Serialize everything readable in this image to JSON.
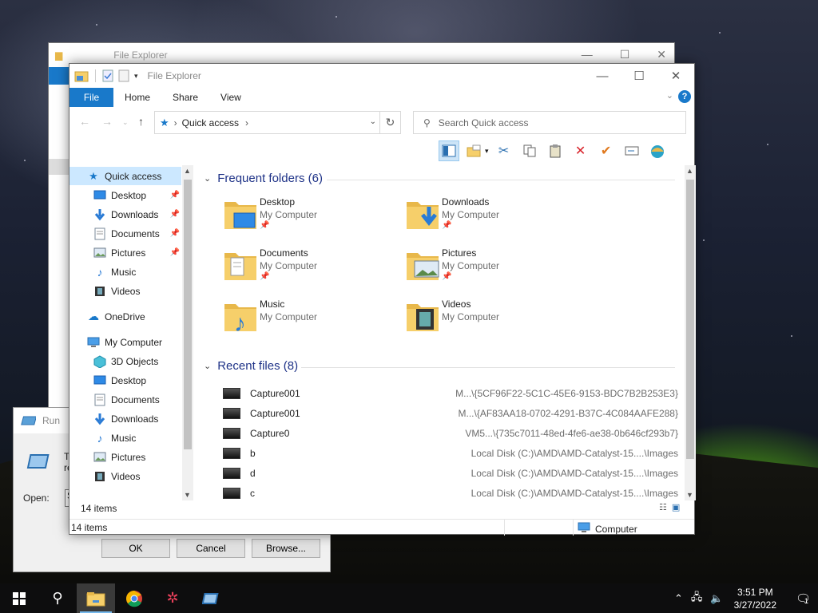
{
  "background_window": {
    "title": "File Explorer"
  },
  "run_dialog": {
    "title": "Run",
    "description_partial": "Ty\nre",
    "open_label": "Open:",
    "open_value": "S",
    "ok_label": "OK",
    "cancel_label": "Cancel",
    "browse_label": "Browse..."
  },
  "explorer": {
    "title": "File Explorer",
    "ribbon_tabs": [
      "File",
      "Home",
      "Share",
      "View"
    ],
    "help_label": "?",
    "address_crumb": "Quick access",
    "search_placeholder": "Search Quick access",
    "nav": [
      {
        "label": "Quick access",
        "icon": "star-icon",
        "selected": true,
        "pinned": false,
        "indent": 0
      },
      {
        "label": "Desktop",
        "icon": "desktop-icon",
        "pinned": true,
        "indent": 1
      },
      {
        "label": "Downloads",
        "icon": "downloads-icon",
        "pinned": true,
        "indent": 1
      },
      {
        "label": "Documents",
        "icon": "documents-icon",
        "pinned": true,
        "indent": 1
      },
      {
        "label": "Pictures",
        "icon": "pictures-icon",
        "pinned": true,
        "indent": 1
      },
      {
        "label": "Music",
        "icon": "music-icon",
        "pinned": false,
        "indent": 1
      },
      {
        "label": "Videos",
        "icon": "videos-icon",
        "pinned": false,
        "indent": 1
      },
      {
        "label": "OneDrive",
        "icon": "cloud-icon",
        "pinned": false,
        "indent": 0
      },
      {
        "label": "My Computer",
        "icon": "computer-icon",
        "pinned": false,
        "indent": 0
      },
      {
        "label": "3D Objects",
        "icon": "cube-icon",
        "pinned": false,
        "indent": 1
      },
      {
        "label": "Desktop",
        "icon": "desktop-icon",
        "pinned": false,
        "indent": 1
      },
      {
        "label": "Documents",
        "icon": "documents-icon",
        "pinned": false,
        "indent": 1
      },
      {
        "label": "Downloads",
        "icon": "downloads-icon",
        "pinned": false,
        "indent": 1
      },
      {
        "label": "Music",
        "icon": "music-icon",
        "pinned": false,
        "indent": 1
      },
      {
        "label": "Pictures",
        "icon": "pictures-icon",
        "pinned": false,
        "indent": 1
      },
      {
        "label": "Videos",
        "icon": "videos-icon",
        "pinned": false,
        "indent": 1
      }
    ],
    "nav_status": "14 items",
    "frequent_header": "Frequent folders (6)",
    "frequent": [
      {
        "name": "Desktop",
        "location": "My Computer",
        "pinned": true,
        "overlay": "desktop"
      },
      {
        "name": "Downloads",
        "location": "My Computer",
        "pinned": true,
        "overlay": "download"
      },
      {
        "name": "Documents",
        "location": "My Computer",
        "pinned": true,
        "overlay": "document"
      },
      {
        "name": "Pictures",
        "location": "My Computer",
        "pinned": true,
        "overlay": "picture"
      },
      {
        "name": "Music",
        "location": "My Computer",
        "pinned": false,
        "overlay": "music"
      },
      {
        "name": "Videos",
        "location": "My Computer",
        "pinned": false,
        "overlay": "video"
      }
    ],
    "recent_header": "Recent files (8)",
    "recent": [
      {
        "name": "Capture001",
        "path": "M...\\{5CF96F22-5C1C-45E6-9153-BDC7B2B253E3}"
      },
      {
        "name": "Capture001",
        "path": "M...\\{AF83AA18-0702-4291-B37C-4C084AAFE288}"
      },
      {
        "name": "Capture0",
        "path": "VM5...\\{735c7011-48ed-4fe6-ae38-0b646cf293b7}"
      },
      {
        "name": "b",
        "path": "Local Disk (C:)\\AMD\\AMD-Catalyst-15....\\Images"
      },
      {
        "name": "d",
        "path": "Local Disk (C:)\\AMD\\AMD-Catalyst-15....\\Images"
      },
      {
        "name": "c",
        "path": "Local Disk (C:)\\AMD\\AMD-Catalyst-15....\\Images"
      }
    ],
    "status_count": "14 items",
    "status_zone": "Computer"
  },
  "taskbar": {
    "time": "3:51 PM",
    "date": "3/27/2022",
    "notification_count": "1"
  },
  "colors": {
    "accent": "#1979ca",
    "folder": "#f6cf6a",
    "taskbar": "#0d0d0e"
  }
}
